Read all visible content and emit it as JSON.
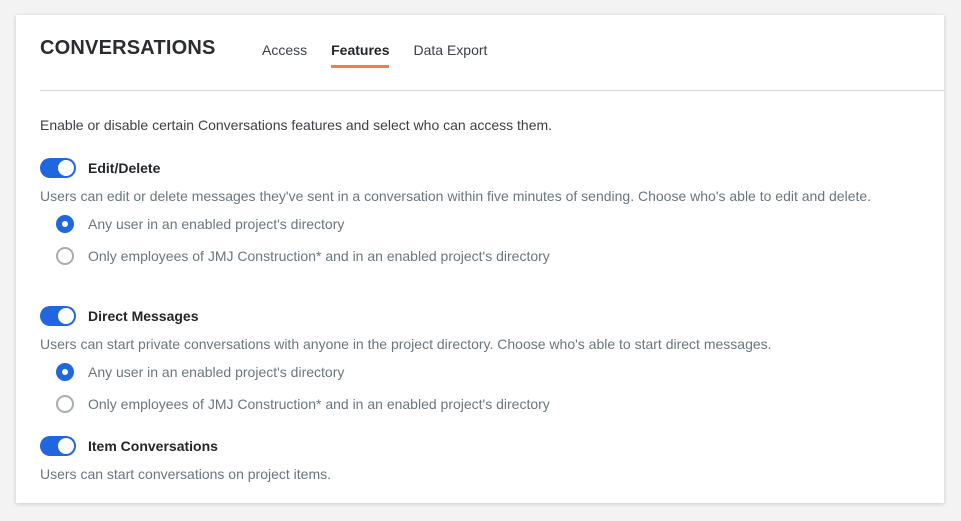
{
  "page": {
    "title": "CONVERSATIONS",
    "tabs": [
      {
        "label": "Access",
        "active": false
      },
      {
        "label": "Features",
        "active": true
      },
      {
        "label": "Data Export",
        "active": false
      }
    ],
    "intro": "Enable or disable certain Conversations features and select who can access them."
  },
  "colors": {
    "accent": "#2066df",
    "tab_indicator": "#f47e42"
  },
  "features": [
    {
      "title": "Edit/Delete",
      "enabled": true,
      "description": "Users can edit or delete messages they've sent in a conversation within five minutes of sending. Choose who's able to edit and delete.",
      "options": [
        {
          "label": "Any user in an enabled project's directory",
          "selected": true
        },
        {
          "label": "Only employees of JMJ Construction* and in an enabled project's directory",
          "selected": false
        }
      ]
    },
    {
      "title": "Direct Messages",
      "enabled": true,
      "description": "Users can start private conversations with anyone in the project directory. Choose who's able to start direct messages.",
      "options": [
        {
          "label": "Any user in an enabled project's directory",
          "selected": true
        },
        {
          "label": "Only employees of JMJ Construction* and in an enabled project's directory",
          "selected": false
        }
      ]
    },
    {
      "title": "Item Conversations",
      "enabled": true,
      "description": "Users can start conversations on project items."
    }
  ]
}
